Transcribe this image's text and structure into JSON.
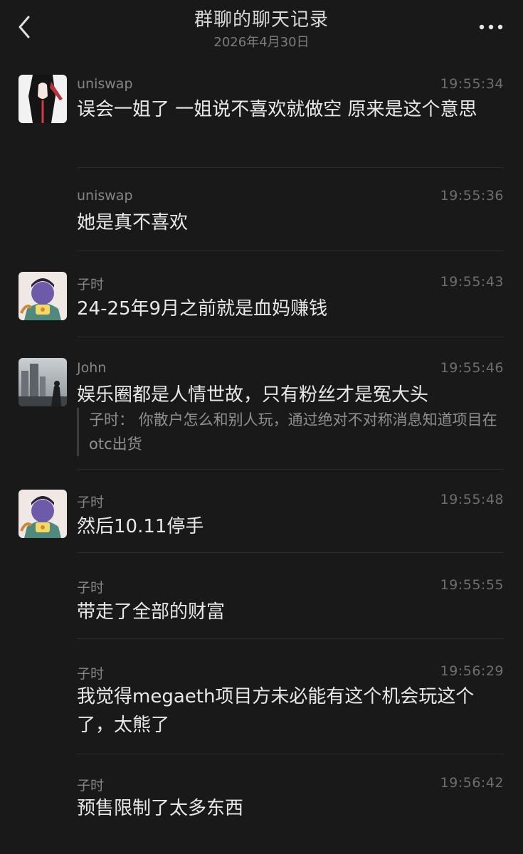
{
  "header": {
    "title": "群聊的聊天记录",
    "date": "2026年4月30日"
  },
  "messages": [
    {
      "sender": "uniswap",
      "time": "19:55:34",
      "text": "误会一姐了 一姐说不喜欢就做空 原来是这个意思"
    },
    {
      "sender": "uniswap",
      "time": "19:55:36",
      "text": "她是真不喜欢"
    },
    {
      "sender": "子时",
      "time": "19:55:43",
      "text": "24-25年9月之前就是血妈赚钱"
    },
    {
      "sender": "John",
      "time": "19:55:46",
      "text": "娱乐圈都是人情世故，只有粉丝才是冤大头",
      "quote": "子时： 你散户怎么和别人玩，通过绝对不对称消息知道项目在otc出货"
    },
    {
      "sender": "子时",
      "time": "19:55:48",
      "text": "然后10.11停手"
    },
    {
      "sender": "子时",
      "time": "19:55:55",
      "text": "带走了全部的财富"
    },
    {
      "sender": "子时",
      "time": "19:56:29",
      "text": "我觉得megaeth项目方未必能有这个机会玩这个了，太熊了"
    },
    {
      "sender": "子时",
      "time": "19:56:42",
      "text": "预售限制了太多东西"
    }
  ],
  "icons": {
    "back": "chevron-left-icon",
    "more": "more-dots-icon"
  },
  "colors": {
    "background": "#191919",
    "text": "#e8e8e8",
    "meta": "#858585"
  }
}
